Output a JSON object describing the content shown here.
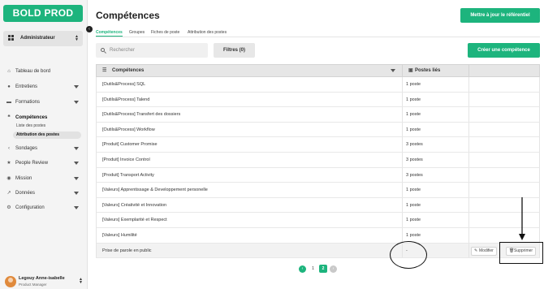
{
  "app": {
    "logo": "BOLD PROD"
  },
  "sidebar": {
    "role": "Administrateur",
    "items": [
      {
        "label": "Tableau de bord",
        "icon": "home-icon"
      },
      {
        "label": "Entretiens",
        "icon": "chat-icon"
      },
      {
        "label": "Formations",
        "icon": "folder-icon"
      },
      {
        "label": "Compétences",
        "icon": "skills-icon"
      },
      {
        "label": "Sondages",
        "icon": "share-icon"
      },
      {
        "label": "People Review",
        "icon": "star-icon"
      },
      {
        "label": "Mission",
        "icon": "compass-icon"
      },
      {
        "label": "Données",
        "icon": "chart-icon"
      },
      {
        "label": "Configuration",
        "icon": "gear-icon"
      }
    ],
    "sub_items": [
      {
        "label": "Liste des postes"
      },
      {
        "label": "Attribution des postes"
      }
    ],
    "user": {
      "name": "Legouy Anne-isabelle",
      "role": "Product Manager"
    }
  },
  "header": {
    "title": "Compétences",
    "update_button": "Mettre à jour le référentiel"
  },
  "tabs": [
    {
      "label": "Compétences"
    },
    {
      "label": "Groupes"
    },
    {
      "label": "Fiches de poste"
    },
    {
      "label": "Attribution des postes"
    }
  ],
  "toolbar": {
    "search_placeholder": "Rechercher",
    "filters_label": "Filtres (0)",
    "create_label": "Créer une compétence"
  },
  "table": {
    "columns": [
      "Compétences",
      "Postes liés",
      ""
    ],
    "rows": [
      {
        "name": "[Outils&Process] SQL",
        "posts": "1 poste"
      },
      {
        "name": "[Outils&Process] Talend",
        "posts": "1 poste"
      },
      {
        "name": "[Outils&Process] Transfert des dossiers",
        "posts": "1 poste"
      },
      {
        "name": "[Outils&Process] Workflow",
        "posts": "1 poste"
      },
      {
        "name": "[Produit] Customer Promise",
        "posts": "3 postes"
      },
      {
        "name": "[Produit] Invoice Control",
        "posts": "3 postes"
      },
      {
        "name": "[Produit] Transport Activity",
        "posts": "3 postes"
      },
      {
        "name": "[Valeurs] Apprentissage & Developpement personelle",
        "posts": "1 poste"
      },
      {
        "name": "[Valeurs] Créativité et Innovation",
        "posts": "1 poste"
      },
      {
        "name": "[Valeurs] Exemplarité et Respect",
        "posts": "1 poste"
      },
      {
        "name": "[Valeurs] Humilité",
        "posts": "1 poste"
      },
      {
        "name": "Prise de parole en public",
        "posts": "-"
      }
    ],
    "row_actions": {
      "edit": "Modifier",
      "delete": "Supprimer"
    }
  },
  "pagination": {
    "prev": "‹",
    "page1": "1",
    "page2": "2",
    "next": "›"
  }
}
